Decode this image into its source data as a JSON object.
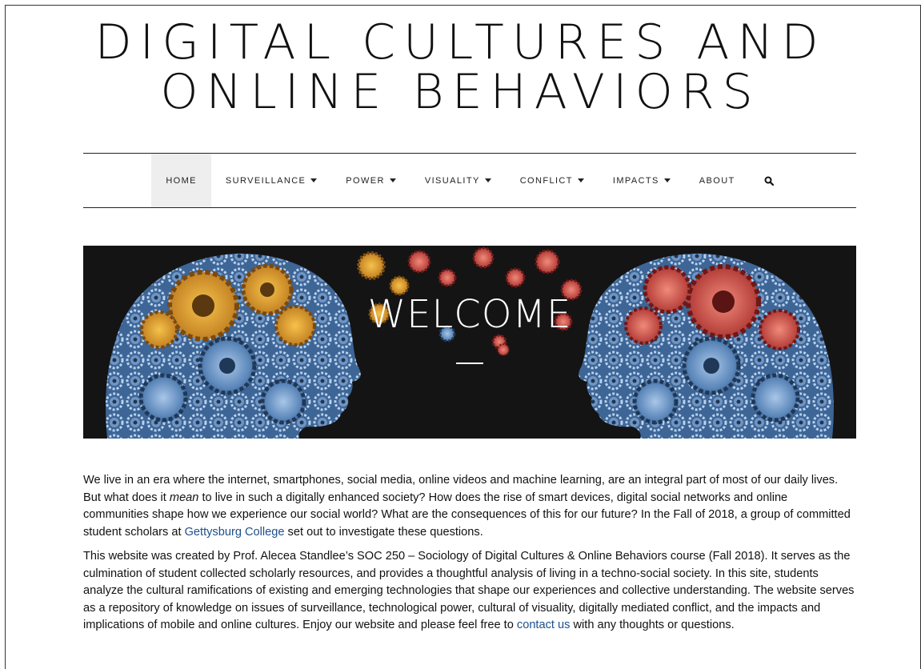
{
  "site": {
    "title_line1": "DIGITAL CULTURES AND",
    "title_line2": "ONLINE BEHAVIORS"
  },
  "nav": {
    "items": [
      {
        "label": "HOME",
        "active": true,
        "dropdown": false
      },
      {
        "label": "SURVEILLANCE",
        "dropdown": true
      },
      {
        "label": "POWER",
        "dropdown": true
      },
      {
        "label": "VISUALITY",
        "dropdown": true
      },
      {
        "label": "CONFLICT",
        "dropdown": true
      },
      {
        "label": "IMPACTS",
        "dropdown": true
      },
      {
        "label": "ABOUT",
        "dropdown": false
      }
    ],
    "search_icon": "search-icon"
  },
  "hero": {
    "title": "WELCOME",
    "image": "two head silhouettes made of gears facing each other"
  },
  "intro": {
    "p1_before_link": "We live in an era where the internet, smartphones, social media, online videos and machine learning, are an integral part of most of our daily lives. But what does it ",
    "p1_em": "mean",
    "p1_middle": " to live in such a digitally enhanced society? How does the rise of smart devices, digital social networks and online communities shape how we experience our social world? What are the consequences of this for our future? In the Fall of 2018, a group of committed student scholars at ",
    "p1_link": "Gettysburg College",
    "p1_after_link": " set out to investigate these questions.",
    "p2_text": "This website was created by Prof. Alecea Standlee’s SOC 250 – Sociology of Digital Cultures & Online Behaviors course (Fall 2018). It serves as the culmination of student collected scholarly resources, and provides a thoughtful analysis of living in a techno-social society. In this site, students analyze the cultural ramifications of existing and emerging technologies that shape our experiences and collective understanding. The website serves as a repository of knowledge on issues of surveillance, technological power, cultural of visuality, digitally mediated conflict, and the impacts and implications of mobile and online cultures. Enjoy our website and please feel free to ",
    "p2_link": "contact us",
    "p2_after_link": " with any thoughts or questions."
  },
  "colors": {
    "link": "#1d4f8c",
    "nav_active_bg": "#eeeeee",
    "hero_bg": "#141414"
  }
}
